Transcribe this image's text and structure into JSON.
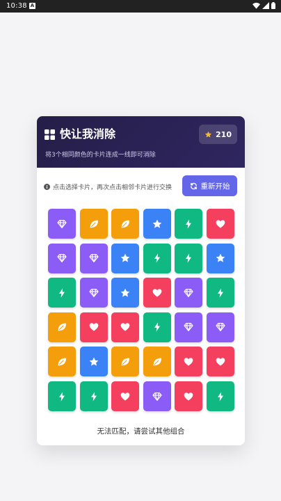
{
  "status_bar": {
    "time": "10:38",
    "notification_letter": "A",
    "icons": [
      "wifi-icon",
      "signal-icon",
      "battery-icon"
    ]
  },
  "header": {
    "title": "快让我消除",
    "subtitle": "将3个相同颜色的卡片连成一线即可消除",
    "score": "210",
    "icons": [
      "grid-icon",
      "star-icon"
    ]
  },
  "controls": {
    "hint": "点击选择卡片，再次点击相邻卡片进行交换",
    "restart_label": "重新开始"
  },
  "board": {
    "rows": [
      [
        "diamond",
        "leaf",
        "leaf",
        "star",
        "bolt",
        "heart"
      ],
      [
        "diamond",
        "diamond",
        "star",
        "bolt",
        "bolt",
        "star"
      ],
      [
        "bolt",
        "diamond",
        "star",
        "heart",
        "diamond",
        "bolt"
      ],
      [
        "leaf",
        "heart",
        "heart",
        "bolt",
        "diamond",
        "diamond"
      ],
      [
        "leaf",
        "star",
        "leaf",
        "leaf",
        "heart",
        "heart"
      ],
      [
        "bolt",
        "bolt",
        "heart",
        "diamond",
        "heart",
        "bolt"
      ]
    ]
  },
  "tile_colors": {
    "diamond": "#8b5cf6",
    "leaf": "#f59e0b",
    "star": "#3b82f6",
    "bolt": "#10b981",
    "heart": "#f43f5e"
  },
  "colors": {
    "header_bg": "#251e48",
    "accent": "#6366e9",
    "star": "#f5b731"
  },
  "footer": {
    "message": "无法匹配，请尝试其他组合"
  }
}
